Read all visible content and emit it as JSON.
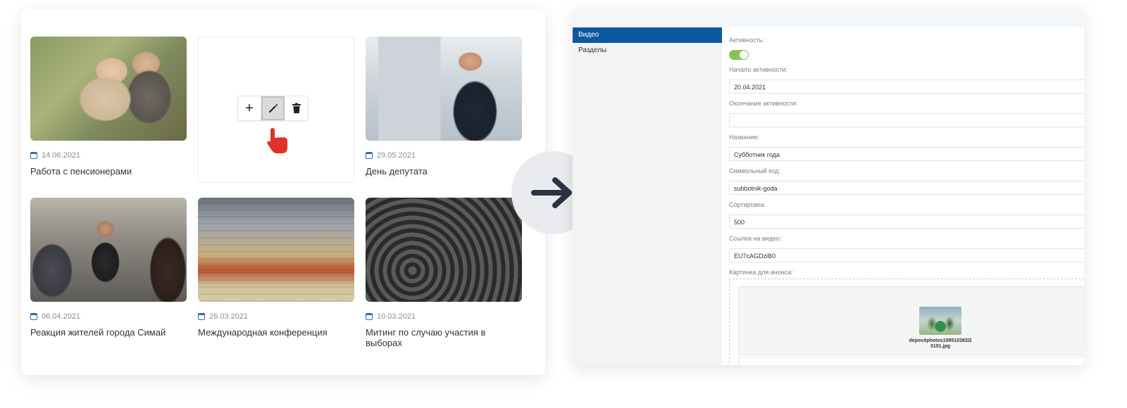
{
  "news": [
    {
      "date": "14.06.2021",
      "title": "Работа с пенсионерами",
      "image": "seniors-photo"
    },
    {
      "date": "",
      "title": "",
      "image": "placeholder"
    },
    {
      "date": "29.05.2021",
      "title": "День депутата",
      "image": "businessman-photo"
    },
    {
      "date": "06.04.2021",
      "title": "Реакция жителей города Симай",
      "image": "crowd-photo"
    },
    {
      "date": "26.03.2021",
      "title": "Международная конференция",
      "image": "conference-photo"
    },
    {
      "date": "10.03.2021",
      "title": "Митинг по случаю участия в выборах",
      "image": "protest-photo"
    }
  ],
  "toolbar": {
    "add_icon": "+",
    "edit_icon": "pencil-icon",
    "delete_icon": "trash-icon"
  },
  "admin": {
    "sidebar": {
      "items": [
        {
          "label": "Видео",
          "active": true
        },
        {
          "label": "Разделы",
          "active": false
        }
      ]
    },
    "form": {
      "activity_label": "Активность:",
      "activity_on": true,
      "start_label": "Начало активности:",
      "start_value": "20.04.2021",
      "end_label": "Окончание активности:",
      "end_value": "",
      "name_label": "Название:",
      "name_value": "Субботник года",
      "code_label": "Символьный код:",
      "code_value": "subbotnik-goda",
      "sort_label": "Сортировка:",
      "sort_value": "500",
      "video_label": "Ссылка на видео:",
      "video_value": "EU7cAGDziB0",
      "image_label": "Картинка для анонса:",
      "image_file": "depositphotos199510382l20151.jpg"
    }
  },
  "colors": {
    "accent": "#0b5aa0",
    "toggle_on": "#86c05d",
    "calendar": "#2f6bb5",
    "cursor": "#e0312b"
  }
}
